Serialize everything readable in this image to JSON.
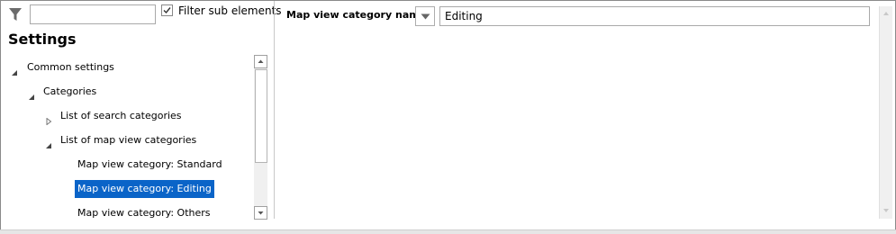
{
  "filter": {
    "input_value": "",
    "checkbox_checked": true,
    "checkbox_label": "Filter sub elements"
  },
  "settings_title": "Settings",
  "tree": {
    "items": [
      {
        "label": "Common settings",
        "expanded": true,
        "selected": false
      },
      {
        "label": "Categories",
        "expanded": true,
        "selected": false
      },
      {
        "label": "List of search categories",
        "expanded": false,
        "selected": false
      },
      {
        "label": "List of map view categories",
        "expanded": true,
        "selected": false
      },
      {
        "label": "Map view category: Standard",
        "expanded": null,
        "selected": false
      },
      {
        "label": "Map view category: Editing",
        "expanded": null,
        "selected": true
      },
      {
        "label": "Map view category: Others",
        "expanded": null,
        "selected": false
      }
    ]
  },
  "property": {
    "label": "Map view category name",
    "value": "Editing"
  },
  "colors": {
    "selection": "#0a64c8",
    "border": "#8a8a8a"
  }
}
